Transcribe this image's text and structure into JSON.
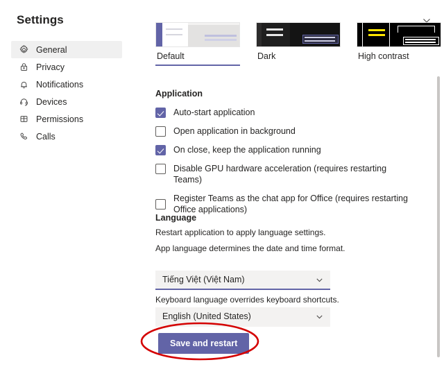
{
  "window": {
    "title": "Settings",
    "close_icon": "close-icon"
  },
  "sidebar": {
    "items": [
      {
        "label": "General",
        "icon": "gear-icon",
        "selected": true
      },
      {
        "label": "Privacy",
        "icon": "lock-icon",
        "selected": false
      },
      {
        "label": "Notifications",
        "icon": "bell-icon",
        "selected": false
      },
      {
        "label": "Devices",
        "icon": "headset-icon",
        "selected": false
      },
      {
        "label": "Permissions",
        "icon": "grid-icon",
        "selected": false
      },
      {
        "label": "Calls",
        "icon": "phone-icon",
        "selected": false
      }
    ]
  },
  "theme": {
    "options": [
      {
        "name": "Default",
        "selected": true
      },
      {
        "name": "Dark",
        "selected": false
      },
      {
        "name": "High contrast",
        "selected": false
      }
    ]
  },
  "application": {
    "heading": "Application",
    "checkboxes": [
      {
        "label": "Auto-start application",
        "checked": true
      },
      {
        "label": "Open application in background",
        "checked": false
      },
      {
        "label": "On close, keep the application running",
        "checked": true
      },
      {
        "label": "Disable GPU hardware acceleration (requires restarting Teams)",
        "checked": false
      },
      {
        "label": "Register Teams as the chat app for Office (requires restarting Office applications)",
        "checked": false
      }
    ]
  },
  "language": {
    "heading": "Language",
    "restart_hint": "Restart application to apply language settings.",
    "app_language_hint": "App language determines the date and time format.",
    "app_language_value": "Tiếng Việt (Việt Nam)",
    "keyboard_language_hint": "Keyboard language overrides keyboard shortcuts.",
    "keyboard_language_value": "English (United States)",
    "save_label": "Save and restart"
  },
  "colors": {
    "accent": "#6264a7",
    "annotation": "#d40000",
    "selected_nav_bg": "#f0f0f0",
    "dropdown_bg": "#f3f2f1",
    "scrollbar": "#c8c6c4"
  }
}
